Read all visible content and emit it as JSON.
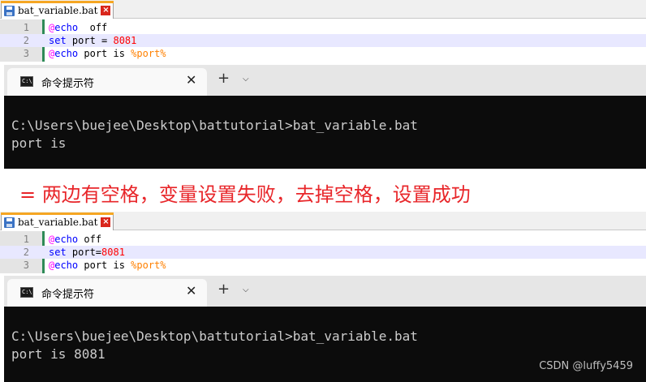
{
  "top": {
    "tab_label": "bat_variable.bat",
    "tab_close": "×",
    "lines": [
      {
        "num": "1",
        "parts": [
          [
            "kw-at",
            "@"
          ],
          [
            "kw",
            "echo"
          ],
          [
            "",
            "  off"
          ]
        ]
      },
      {
        "num": "2",
        "parts": [
          [
            "kw",
            "set"
          ],
          [
            "",
            " port = "
          ],
          [
            "num",
            "8081"
          ]
        ]
      },
      {
        "num": "3",
        "parts": [
          [
            "kw-at",
            "@"
          ],
          [
            "kw",
            "echo"
          ],
          [
            "",
            " port is "
          ],
          [
            "var",
            "%port%"
          ]
        ]
      }
    ],
    "terminal": {
      "tab_label": "命令提示符",
      "close": "✕",
      "new_tab": "+",
      "dropdown": "⌵",
      "output_line1": "C:\\Users\\buejee\\Desktop\\battutorial>bat_variable.bat",
      "output_line2": "port is"
    }
  },
  "caption": "= 两边有空格，变量设置失败，去掉空格，设置成功",
  "bottom": {
    "tab_label": "bat_variable.bat",
    "tab_close": "×",
    "lines": [
      {
        "num": "1",
        "parts": [
          [
            "kw-at",
            "@"
          ],
          [
            "kw",
            "echo"
          ],
          [
            "",
            " off"
          ]
        ]
      },
      {
        "num": "2",
        "parts": [
          [
            "kw",
            "set"
          ],
          [
            "",
            " port="
          ],
          [
            "num",
            "8081"
          ]
        ]
      },
      {
        "num": "3",
        "parts": [
          [
            "kw-at",
            "@"
          ],
          [
            "kw",
            "echo"
          ],
          [
            "",
            " port is "
          ],
          [
            "var",
            "%port%"
          ]
        ]
      }
    ],
    "terminal": {
      "tab_label": "命令提示符",
      "close": "✕",
      "new_tab": "+",
      "dropdown": "⌵",
      "output_line1": "C:\\Users\\buejee\\Desktop\\battutorial>bat_variable.bat",
      "output_line2": "port is 8081"
    }
  },
  "watermark": "CSDN @luffy5459",
  "colors": {
    "caption": "#e8262a",
    "terminal_bg": "#0c0c0c",
    "terminal_fg": "#cccccc",
    "keyword": "#0000ff",
    "at_sign": "#ff00ff",
    "number": "#ff0000",
    "variable": "#ff8000"
  }
}
